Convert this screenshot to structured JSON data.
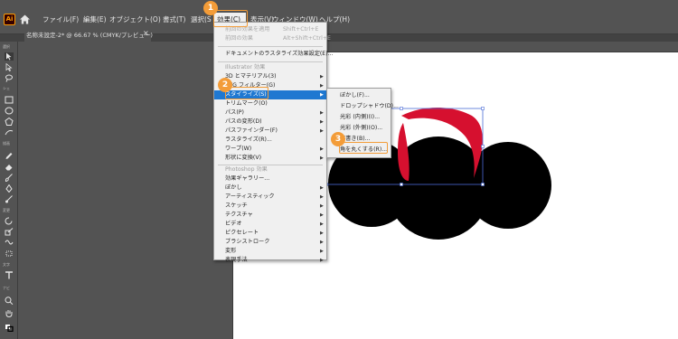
{
  "app": {
    "icon_text": "Ai"
  },
  "menubar": {
    "items": [
      {
        "label": "ファイル(F)"
      },
      {
        "label": "編集(E)"
      },
      {
        "label": "オブジェクト(O)"
      },
      {
        "label": "書式(T)"
      },
      {
        "label": "選択(S"
      },
      {
        "label": "効果(C)"
      },
      {
        "label": "表示(V)"
      },
      {
        "label": "ウィンドウ(W)"
      },
      {
        "label": "ヘルプ(H)"
      }
    ]
  },
  "document_tab": {
    "label": "名称未設定-2* @ 66.67 % (CMYK/プレビュー)",
    "close": "×"
  },
  "tools_panel": {
    "labels": [
      "選択",
      "シェ",
      "描画",
      "変更",
      "文字",
      "ナビ"
    ]
  },
  "effect_menu": {
    "items": [
      {
        "label": "前回の効果を適用",
        "shortcut": "Shift+Ctrl+E",
        "state": "disabled"
      },
      {
        "label": "前回の効果",
        "shortcut": "Alt+Shift+Ctrl+E",
        "state": "disabled"
      },
      {
        "label": "ドキュメントのラスタライズ効果設定(E)...",
        "state": "normal"
      },
      {
        "label": "Illustrator 効果",
        "state": "header"
      },
      {
        "label": "3D とマテリアル(3)",
        "submenu": true
      },
      {
        "label": "SVG フィルター(G)",
        "submenu": true
      },
      {
        "label": "スタイライズ(S)",
        "submenu": true,
        "state": "highlight"
      },
      {
        "label": "トリムマーク(O)"
      },
      {
        "label": "パス(P)",
        "submenu": true
      },
      {
        "label": "パスの変形(D)",
        "submenu": true
      },
      {
        "label": "パスファインダー(F)",
        "submenu": true
      },
      {
        "label": "ラスタライズ(R)..."
      },
      {
        "label": "ワープ(W)",
        "submenu": true
      },
      {
        "label": "形状に変換(V)",
        "submenu": true
      },
      {
        "label": "Photoshop 効果",
        "state": "header"
      },
      {
        "label": "効果ギャラリー..."
      },
      {
        "label": "ぼかし",
        "submenu": true
      },
      {
        "label": "アーティスティック",
        "submenu": true
      },
      {
        "label": "スケッチ",
        "submenu": true
      },
      {
        "label": "テクスチャ",
        "submenu": true
      },
      {
        "label": "ビデオ",
        "submenu": true
      },
      {
        "label": "ピクセレート",
        "submenu": true
      },
      {
        "label": "ブラシストローク",
        "submenu": true
      },
      {
        "label": "変形",
        "submenu": true
      },
      {
        "label": "表現手法",
        "submenu": true
      }
    ]
  },
  "stylize_submenu": {
    "items": [
      {
        "label": "ぼかし(F)..."
      },
      {
        "label": "ドロップシャドウ(D)..."
      },
      {
        "label": "光彩 (内側)(I)..."
      },
      {
        "label": "光彩 (外側)(O)..."
      },
      {
        "label": "落書き(B)..."
      },
      {
        "label": "角を丸くする(R)..."
      }
    ]
  },
  "callouts": [
    {
      "number": "1"
    },
    {
      "number": "2"
    },
    {
      "number": "3"
    }
  ],
  "colors": {
    "ui_dark": "#535353",
    "menu_bg": "#f0f0f0",
    "menu_highlight": "#1f78d1",
    "callout": "#f39c38",
    "selection": "#4a6bd6",
    "art_black": "#000000",
    "art_red": "#d6102f"
  }
}
